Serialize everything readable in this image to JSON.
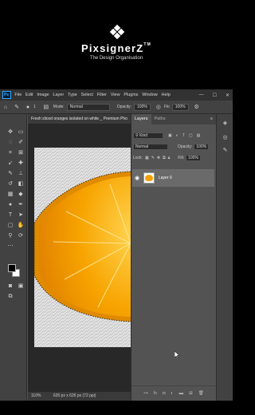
{
  "brand": {
    "name": "PixsignerZ",
    "tm": "TM",
    "tagline": "The Design Organisation"
  },
  "app": {
    "logo": "Ps",
    "menu": [
      "File",
      "Edit",
      "Image",
      "Layer",
      "Type",
      "Select",
      "Filter",
      "View",
      "Plugins",
      "Window",
      "Help"
    ],
    "window_controls": [
      "—",
      "☐",
      "✕"
    ]
  },
  "options": {
    "home_icon": "home-icon",
    "brush_size": "1",
    "mode_label": "Mode:",
    "mode_value": "Normal",
    "opacity_label": "Opacity:",
    "opacity_value": "100%",
    "flow_label": "Flo",
    "flow_value": "100%"
  },
  "document": {
    "tab_title": "Fresh sliced oranges isolated on white _ Premium Pho",
    "zoom": "110%",
    "size": "626 px x 626 px (72 ppi)"
  },
  "layers": {
    "tab_layers": "Layers",
    "tab_paths": "Paths",
    "filter_label": "Kind",
    "blend_mode": "Normal",
    "opacity_label": "Opacity:",
    "opacity_value": "100%",
    "lock_label": "Lock:",
    "fill_label": "Fill:",
    "fill_value": "100%",
    "layer_name": "Layer 0"
  },
  "colors": {
    "accent": "#31a8ff",
    "orange": "#f5a000",
    "panel_bg": "#535353",
    "canvas_bg": "#282828"
  }
}
